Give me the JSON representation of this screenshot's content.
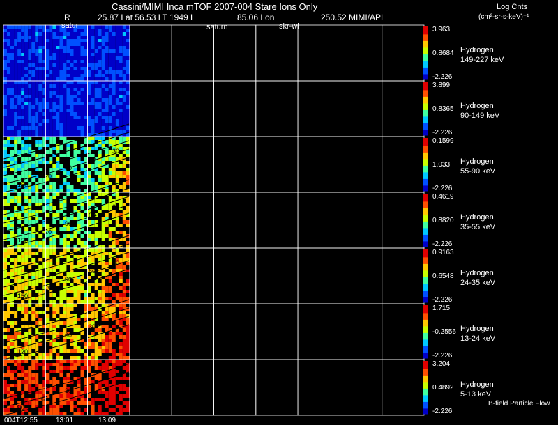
{
  "header": {
    "title": "Cassini/MIMI Inca mTOF  2007-004   Stare    Ions Only",
    "r_label": "R",
    "lat_line": "25.87 Lat 56.53 LT 1949 L",
    "lon_line": "85.06 Lon",
    "mimi_line": "250.52  MIMI/APL",
    "top_labels": [
      "satur",
      "saturn",
      "skr-wl"
    ]
  },
  "colorbar_title": "Log Cnts",
  "colorbar_units": "(cm²-sr-s-keV)⁻¹",
  "colors": {
    "background": "#000000",
    "grid": "#ffffff",
    "colormap": [
      "#0000c8",
      "#0050ff",
      "#00c8ff",
      "#40ffa0",
      "#c8ff00",
      "#ffc800",
      "#ff5000",
      "#e00000"
    ]
  },
  "chart_data": {
    "type": "heatmap",
    "columns": 10,
    "filled_columns": 3,
    "time_labels": [
      "004T12:55",
      "13:01",
      "13:09"
    ],
    "footer_note": "B-field Particle Flow",
    "rows": [
      {
        "species": "Hydrogen",
        "energy": "149-227 keV",
        "scale": [
          "3.963",
          "0.8684",
          "-2.226"
        ],
        "level": 0.08,
        "contours": []
      },
      {
        "species": "Hydrogen",
        "energy": "90-149 keV",
        "scale": [
          "3.899",
          "0.8365",
          "-2.226"
        ],
        "level": 0.08,
        "contours": []
      },
      {
        "species": "Hydrogen",
        "energy": "55-90 keV",
        "scale": [
          "0.1599",
          "1.033",
          "-2.226"
        ],
        "level": 0.35,
        "contours": [
          "150",
          "120",
          "90",
          "60",
          "30"
        ]
      },
      {
        "species": "Hydrogen",
        "energy": "35-55 keV",
        "scale": [
          "0.4619",
          "0.8820",
          "-2.226"
        ],
        "level": 0.42,
        "contours": [
          "150",
          "120",
          "90",
          "60",
          "30"
        ]
      },
      {
        "species": "Hydrogen",
        "energy": "24-35 keV",
        "scale": [
          "0.9163",
          "0.6548",
          "-2.226"
        ],
        "level": 0.55,
        "contours": [
          "150",
          "120",
          "90",
          "60",
          "30"
        ]
      },
      {
        "species": "Hydrogen",
        "energy": "13-24 keV",
        "scale": [
          "1.715",
          "-0.2556",
          "-2.226"
        ],
        "level": 0.62,
        "contours": [
          "120",
          "90",
          "60",
          "30"
        ]
      },
      {
        "species": "Hydrogen",
        "energy": "5-13 keV",
        "scale": [
          "3.204",
          "0.4892",
          "-2.226"
        ],
        "level": 0.8,
        "contours": [
          "90",
          "60",
          "30"
        ]
      }
    ]
  }
}
